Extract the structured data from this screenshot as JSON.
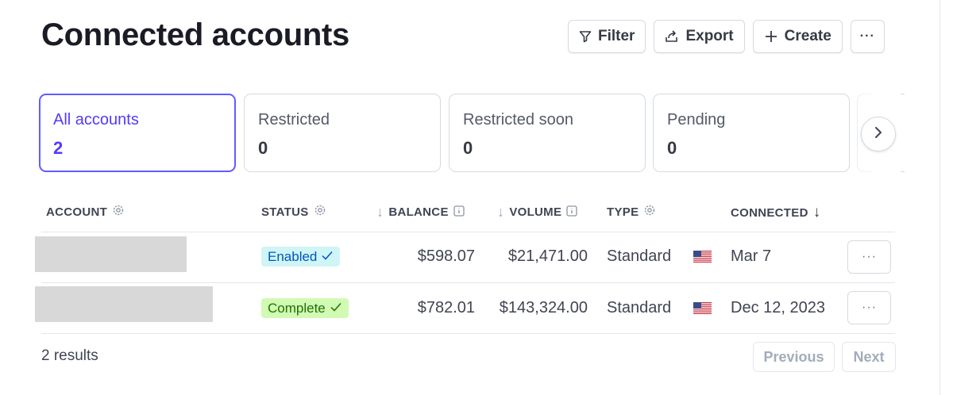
{
  "page": {
    "title": "Connected accounts"
  },
  "toolbar": {
    "filter_label": "Filter",
    "export_label": "Export",
    "create_label": "Create",
    "more_label": "···"
  },
  "cards": [
    {
      "label": "All accounts",
      "count": "2"
    },
    {
      "label": "Restricted",
      "count": "0"
    },
    {
      "label": "Restricted soon",
      "count": "0"
    },
    {
      "label": "Pending",
      "count": "0"
    }
  ],
  "table": {
    "columns": {
      "account": "ACCOUNT",
      "status": "STATUS",
      "balance": "BALANCE",
      "volume": "VOLUME",
      "type": "TYPE",
      "connected": "CONNECTED"
    },
    "rows": [
      {
        "status": "Enabled",
        "balance": "$598.07",
        "volume": "$21,471.00",
        "type": "Standard",
        "country_flag": "us-flag-icon",
        "connected": "Mar 7"
      },
      {
        "status": "Complete",
        "balance": "$782.01",
        "volume": "$143,324.00",
        "type": "Standard",
        "country_flag": "us-flag-icon",
        "connected": "Dec 12, 2023"
      }
    ],
    "row_more_label": "···"
  },
  "footer": {
    "results_text": "2 results",
    "previous_label": "Previous",
    "next_label": "Next"
  },
  "colors": {
    "accent": "#533afd",
    "enabled_badge_bg": "#cff5f6",
    "enabled_badge_text": "#0055bc",
    "complete_badge_bg": "#d1fab3",
    "complete_badge_text": "#217005"
  }
}
